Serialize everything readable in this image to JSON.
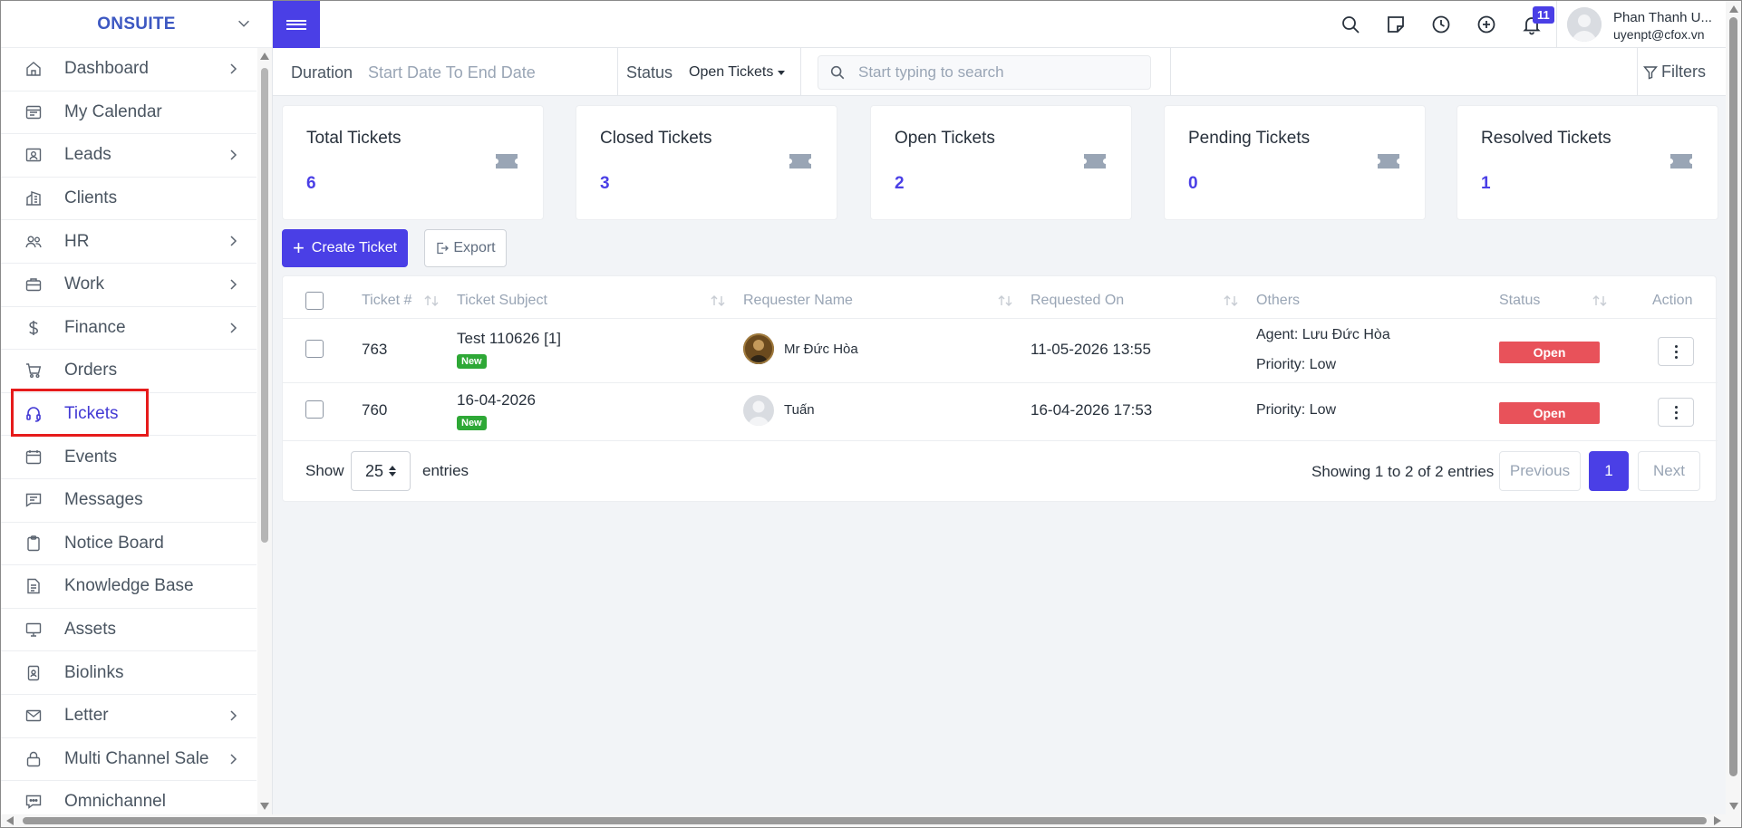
{
  "brand": {
    "name": "ONSUITE"
  },
  "sidebar": {
    "items": [
      {
        "label": "Dashboard",
        "icon": "home-icon",
        "has_submenu": true
      },
      {
        "label": "My Calendar",
        "icon": "calendar-icon",
        "has_submenu": false
      },
      {
        "label": "Leads",
        "icon": "id-card-icon",
        "has_submenu": true
      },
      {
        "label": "Clients",
        "icon": "building-icon",
        "has_submenu": false
      },
      {
        "label": "HR",
        "icon": "people-icon",
        "has_submenu": true
      },
      {
        "label": "Work",
        "icon": "briefcase-icon",
        "has_submenu": true
      },
      {
        "label": "Finance",
        "icon": "dollar-icon",
        "has_submenu": true
      },
      {
        "label": "Orders",
        "icon": "cart-icon",
        "has_submenu": false
      },
      {
        "label": "Tickets",
        "icon": "headset-icon",
        "has_submenu": false,
        "active": true
      },
      {
        "label": "Events",
        "icon": "calendar-event-icon",
        "has_submenu": false
      },
      {
        "label": "Messages",
        "icon": "chat-icon",
        "has_submenu": false
      },
      {
        "label": "Notice Board",
        "icon": "clipboard-icon",
        "has_submenu": false
      },
      {
        "label": "Knowledge Base",
        "icon": "document-icon",
        "has_submenu": false
      },
      {
        "label": "Assets",
        "icon": "monitor-icon",
        "has_submenu": false
      },
      {
        "label": "Biolinks",
        "icon": "badge-icon",
        "has_submenu": false
      },
      {
        "label": "Letter",
        "icon": "envelope-icon",
        "has_submenu": true
      },
      {
        "label": "Multi Channel Sale",
        "icon": "lock-bag-icon",
        "has_submenu": true
      },
      {
        "label": "Omnichannel",
        "icon": "chat-dots-icon",
        "has_submenu": false
      }
    ]
  },
  "topbar": {
    "notification_count": "11",
    "user": {
      "name": "Phan Thanh U...",
      "email": "uyenpt@cfox.vn"
    }
  },
  "filters": {
    "duration_label": "Duration",
    "date_range_placeholder": "Start Date To End Date",
    "status_label": "Status",
    "status_value": "Open Tickets",
    "search_placeholder": "Start typing to search",
    "filters_label": "Filters"
  },
  "stats": [
    {
      "title": "Total Tickets",
      "value": "6"
    },
    {
      "title": "Closed Tickets",
      "value": "3"
    },
    {
      "title": "Open Tickets",
      "value": "2"
    },
    {
      "title": "Pending Tickets",
      "value": "0"
    },
    {
      "title": "Resolved Tickets",
      "value": "1"
    }
  ],
  "actions": {
    "create_label": "Create Ticket",
    "export_label": "Export"
  },
  "table": {
    "headers": {
      "ticket_no": "Ticket #",
      "subject": "Ticket Subject",
      "requester": "Requester Name",
      "requested_on": "Requested On",
      "others": "Others",
      "status": "Status",
      "action": "Action"
    },
    "rows": [
      {
        "ticket_no": "763",
        "subject": "Test 110626 [1]",
        "badge": "New",
        "requester": "Mr Đức Hòa",
        "requested_on": "11-05-2026 13:55",
        "agent": "Agent: Lưu Đức Hòa",
        "priority": "Priority: Low",
        "status": "Open"
      },
      {
        "ticket_no": "760",
        "subject": "16-04-2026",
        "badge": "New",
        "requester": "Tuấn",
        "requested_on": "16-04-2026 17:53",
        "priority": "Priority: Low",
        "status": "Open"
      }
    ]
  },
  "pagination": {
    "show_label": "Show",
    "entries_value": "25",
    "entries_label": "entries",
    "summary": "Showing 1 to 2 of 2 entries",
    "previous": "Previous",
    "current": "1",
    "next": "Next"
  },
  "colors": {
    "brand": "#3d58c2",
    "primary": "#4a3fe6",
    "status_open": "#e8525a",
    "badge_new": "#2ea836",
    "highlight": "#e61b1b"
  }
}
